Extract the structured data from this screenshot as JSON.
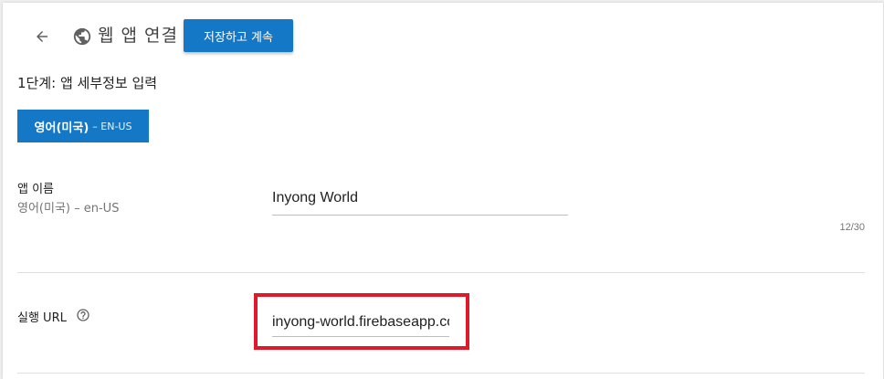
{
  "header": {
    "back_icon": "arrow-left-icon",
    "globe_icon": "globe-icon",
    "title": "웹 앱 연결",
    "save_continue_label": "저장하고 계속"
  },
  "step": {
    "label": "1단계: 앱 세부정보 입력"
  },
  "language_tab": {
    "name": "영어(미국)",
    "code": "– EN-US",
    "active_color": "#1478c7"
  },
  "fields": {
    "app_name": {
      "label": "앱 이름",
      "sublabel": "영어(미국) – en-US",
      "value": "Inyong World",
      "counter": "12/30"
    },
    "launch_url": {
      "label": "실행 URL",
      "help_icon": "help-circle-icon",
      "value": "inyong-world.firebaseapp.com"
    }
  },
  "colors": {
    "primary": "#1478c7",
    "highlight": "#e0192a"
  }
}
